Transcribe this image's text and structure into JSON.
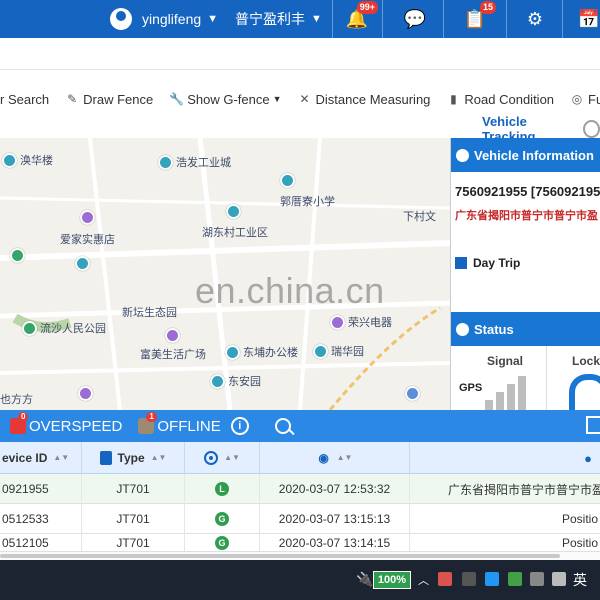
{
  "header": {
    "username": "yinglifeng",
    "company": "普宁盈利丰",
    "notifications_badge": "99+",
    "tasks_badge": "15"
  },
  "toolbar": {
    "items": [
      "r Search",
      "Draw Fence",
      "Show G-fence",
      "Distance Measuring",
      "Road Condition",
      "Full I"
    ],
    "vehicle_tracking": "Vehicle Tracking"
  },
  "map": {
    "pois": [
      "涣华楼",
      "浩发工业城",
      "郭厝寮小学",
      "下村文",
      "爱家实惠店",
      "湖东村工业区",
      "流沙人民公园",
      "新坛生态园",
      "荣兴电器",
      "富美生活广场",
      "东埔办公楼",
      "瑞华园",
      "东安园",
      "也方方"
    ],
    "watermark": "en.china.cn"
  },
  "vehicle_panel": {
    "title": "Vehicle Information",
    "ids": "7560921955 [7560921955",
    "address": "广东省揭阳市普宁市普宁市盈",
    "day_trip": "Day Trip",
    "status_title": "Status",
    "signal_label": "Signal",
    "lock_label": "Lock",
    "gps_label": "GPS"
  },
  "bottombar": {
    "overspeed_label": "OVERSPEED",
    "overspeed_count": "0",
    "offline_label": "OFFLINE",
    "offline_count": "1",
    "info": "i"
  },
  "table": {
    "headers": [
      "evice ID",
      "Type"
    ],
    "rows": [
      {
        "device": "0921955",
        "type": "JT701",
        "status": "L",
        "time": "2020-03-07 12:53:32",
        "location": "广东省揭阳市普宁市普宁市盈利"
      },
      {
        "device": "0512533",
        "type": "JT701",
        "status": "G",
        "time": "2020-03-07 13:15:13",
        "location": "Positio"
      },
      {
        "device": "0512105",
        "type": "JT701",
        "status": "G",
        "time": "2020-03-07 13:14:15",
        "location": "Positio"
      }
    ]
  },
  "taskbar": {
    "battery": "100%",
    "ime": "英"
  }
}
